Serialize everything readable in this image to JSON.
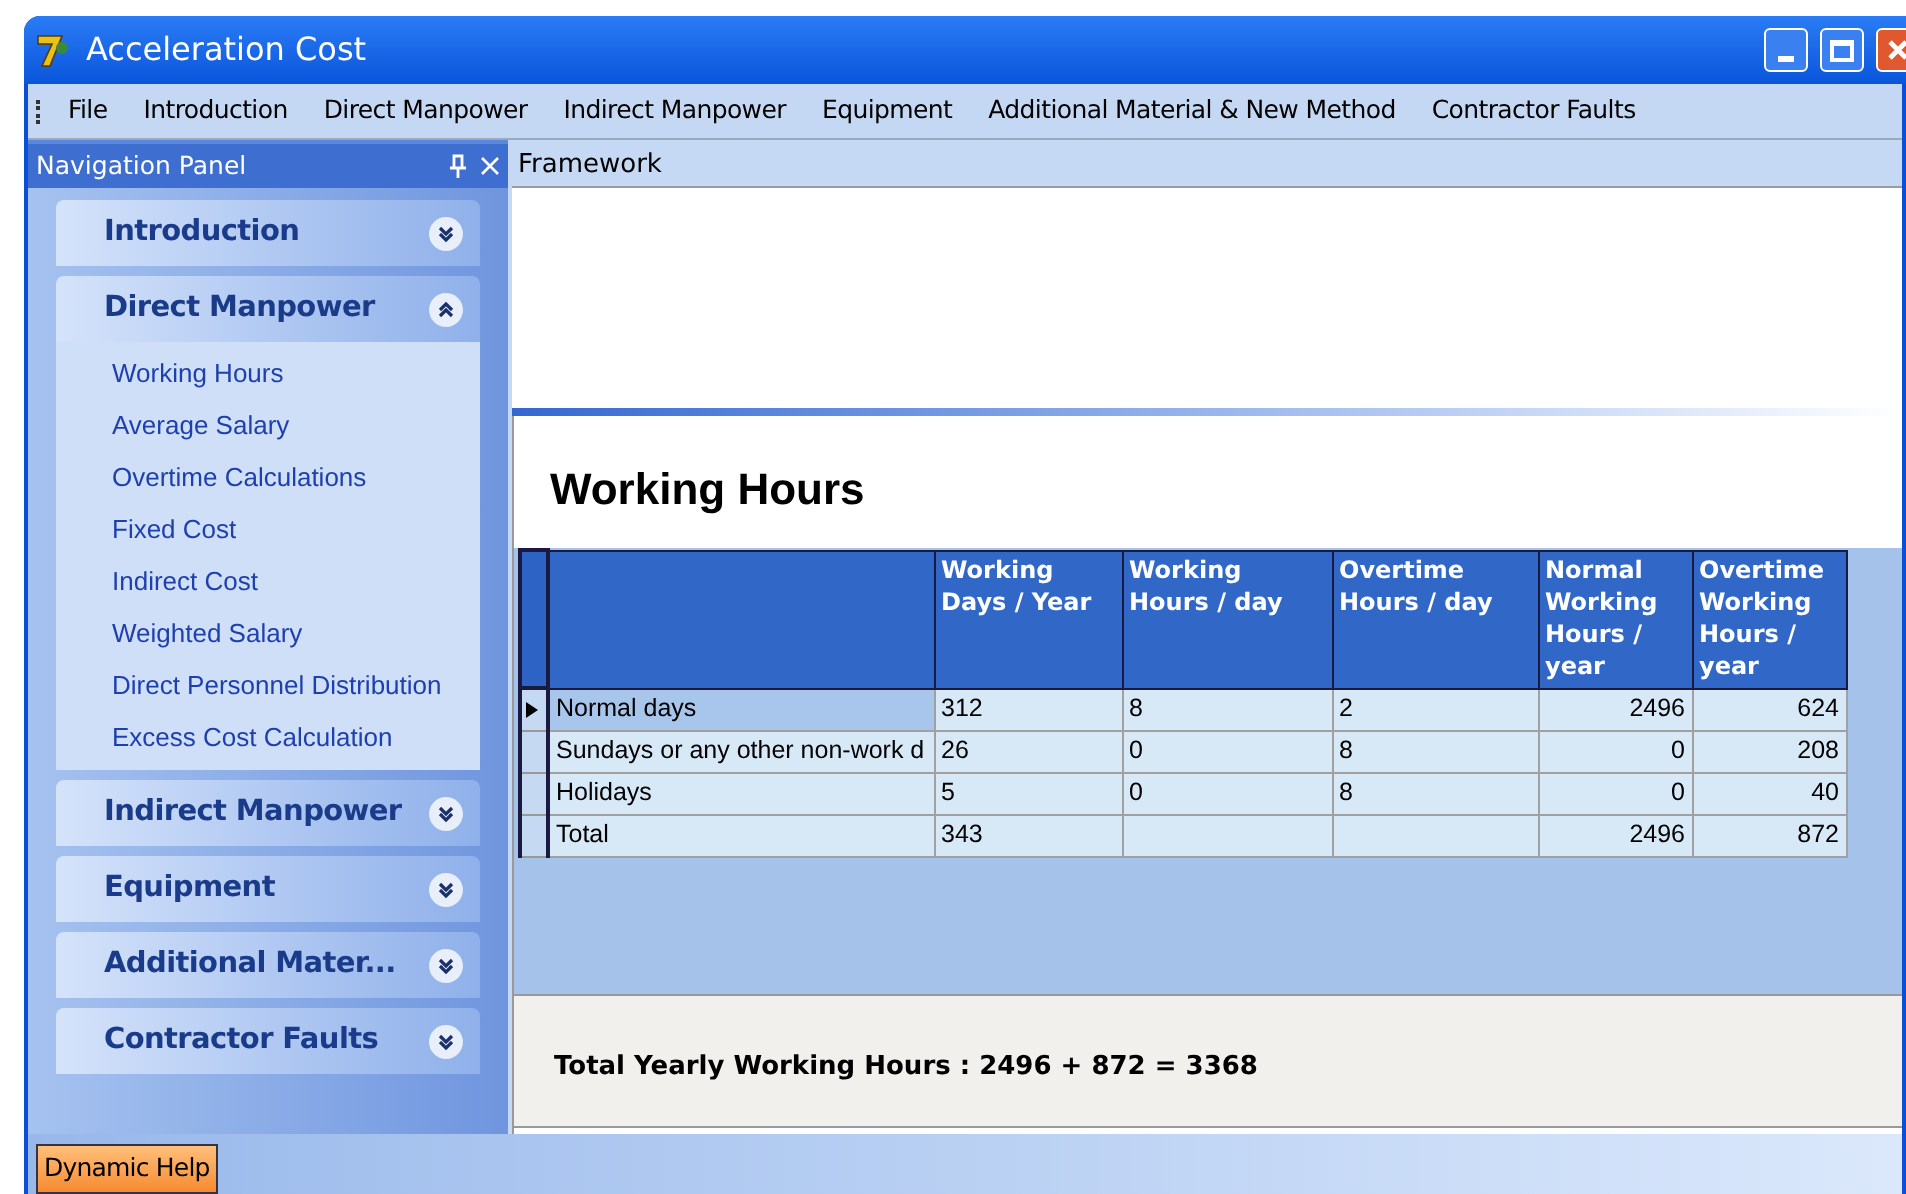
{
  "window": {
    "title": "Acceleration Cost"
  },
  "menu": [
    "File",
    "Introduction",
    "Direct Manpower",
    "Indirect Manpower",
    "Equipment",
    "Additional Material & New Method",
    "Contractor Faults"
  ],
  "navigation_panel": {
    "title": "Navigation Panel",
    "groups": [
      {
        "label": "Introduction",
        "expanded": false
      },
      {
        "label": "Direct Manpower",
        "expanded": true,
        "items": [
          "Working Hours",
          "Average Salary",
          "Overtime Calculations",
          "Fixed Cost",
          "Indirect Cost",
          "Weighted Salary",
          "Direct Personnel Distribution",
          "Excess Cost Calculation"
        ]
      },
      {
        "label": "Indirect Manpower",
        "expanded": false
      },
      {
        "label": "Equipment",
        "expanded": false
      },
      {
        "label": "Additional Mater...",
        "expanded": false
      },
      {
        "label": "Contractor Faults",
        "expanded": false
      }
    ]
  },
  "document_tab": "Framework",
  "page": {
    "title": "Working Hours",
    "table": {
      "columns": [
        "",
        "Working Days / Year",
        "Working Hours / day",
        "Overtime Hours / day",
        "Normal Working Hours / year",
        "Overtime Working Hours / year"
      ],
      "rows": [
        {
          "selected": true,
          "cells": [
            "Normal days",
            "312",
            "8",
            "2",
            "2496",
            "624"
          ]
        },
        {
          "selected": false,
          "cells": [
            "Sundays or any other non-work d",
            "26",
            "0",
            "8",
            "0",
            "208"
          ]
        },
        {
          "selected": false,
          "cells": [
            "Holidays",
            "5",
            "0",
            "8",
            "0",
            "40"
          ]
        },
        {
          "selected": false,
          "cells": [
            "Total",
            "343",
            "",
            "",
            "2496",
            "872"
          ]
        }
      ]
    },
    "summary": "Total Yearly Working Hours : 2496 + 872 = 3368"
  },
  "bottom_tab": "Dynamic Help"
}
